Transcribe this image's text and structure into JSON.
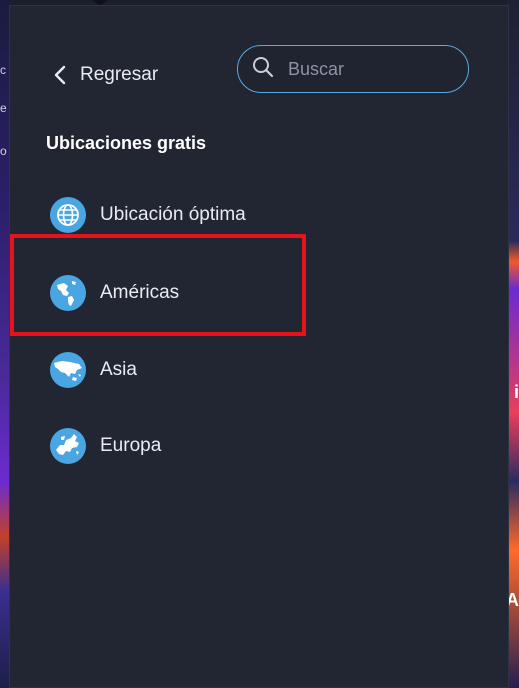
{
  "header": {
    "back_label": "Regresar",
    "search_placeholder": "Buscar"
  },
  "section": {
    "title": "Ubicaciones gratis"
  },
  "locations": [
    {
      "label": "Ubicación óptima",
      "icon": "globe-grid-icon"
    },
    {
      "label": "Américas",
      "icon": "globe-americas-icon"
    },
    {
      "label": "Asia",
      "icon": "globe-asia-icon"
    },
    {
      "label": "Europa",
      "icon": "globe-europe-icon"
    }
  ],
  "colors": {
    "panel_bg": "#212632",
    "accent_blue": "#4aa6e2",
    "search_border": "#5aa8e0",
    "highlight_red": "#e6131a"
  }
}
